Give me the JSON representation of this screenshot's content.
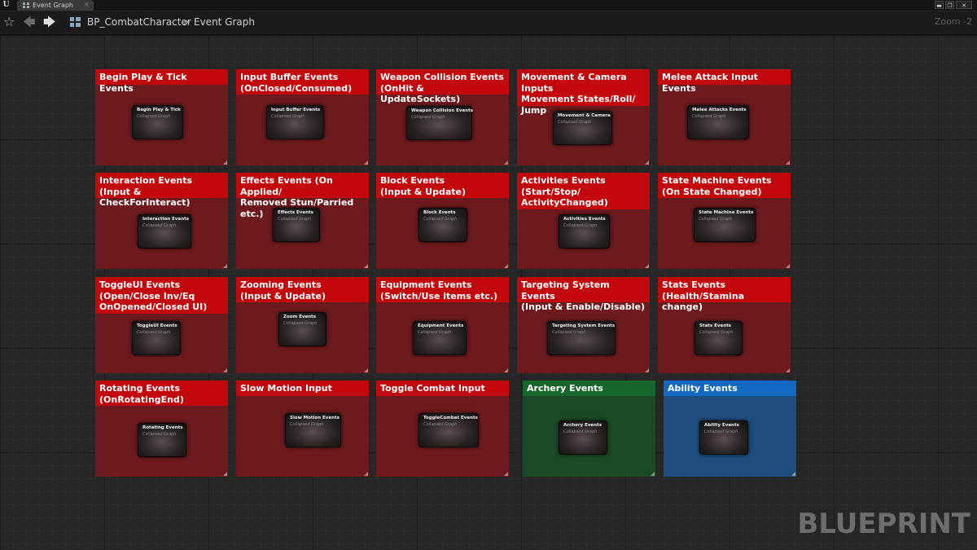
{
  "window": {
    "tab_label": "Event Graph",
    "tab_close": "×",
    "logo_text": "U",
    "controls": [
      "▬",
      "❐",
      "✕"
    ]
  },
  "navbar": {
    "star_icon": "☆",
    "back_icon": "🡄",
    "forward_icon": "🡆",
    "breadcrumb_blueprint": "BP_CombatCharacter",
    "breadcrumb_separator": ">",
    "breadcrumb_graph": "Event Graph",
    "zoom": "Zoom -2"
  },
  "watermark": "BLUEPRINT",
  "colors": {
    "red_header": "#c2080c",
    "red_body": "#6c1a1d",
    "green_header": "#17662c",
    "green_body": "#1a4a25",
    "blue_header": "#1468c4",
    "blue_body": "#1c4d7c",
    "canvas": "#262626"
  },
  "comments": [
    {
      "title": "Begin Play & Tick Events",
      "color": "red",
      "node_title": "Begin Play & Tick",
      "node_sub": "Collapsed Graph"
    },
    {
      "title": "Input Buffer Events\n(OnClosed/Consumed)",
      "color": "red",
      "node_title": "Input Buffer Events",
      "node_sub": "Collapsed Graph"
    },
    {
      "title": "Weapon Collision Events\n(OnHit & UpdateSockets)",
      "color": "red",
      "node_title": "Weapon Collision Events",
      "node_sub": "Collapsed Graph"
    },
    {
      "title": "Movement & Camera Inputs\nMovement States/Roll/\nJump",
      "color": "red",
      "node_title": "Movement & Camera",
      "node_sub": "Collapsed Graph"
    },
    {
      "title": "Melee Attack Input Events",
      "color": "red",
      "node_title": "Melee Attacks Events",
      "node_sub": "Collapsed Graph"
    },
    {
      "title": "Interaction Events\n(Input & CheckForInteract)",
      "color": "red",
      "node_title": "Interaction Events",
      "node_sub": "Collapsed Graph"
    },
    {
      "title": "Effects Events (On Applied/\nRemoved Stun/Parried etc.)",
      "color": "red",
      "node_title": "Effects Events",
      "node_sub": "Collapsed Graph"
    },
    {
      "title": "Block Events\n(Input & Update)",
      "color": "red",
      "node_title": "Block Events",
      "node_sub": "Collapsed Graph"
    },
    {
      "title": "Activities Events\n(Start/Stop/\nActivityChanged)",
      "color": "red",
      "node_title": "Activities Events",
      "node_sub": "Collapsed Graph"
    },
    {
      "title": "State Machine Events\n(On State Changed)",
      "color": "red",
      "node_title": "State Machine Events",
      "node_sub": "Collapsed Graph"
    },
    {
      "title": "ToggleUI Events\n(Open/Close Inv/Eq\nOnOpened/Closed UI)",
      "color": "red",
      "node_title": "ToggleUI Events",
      "node_sub": "Collapsed Graph"
    },
    {
      "title": "Zooming Events\n(Input & Update)",
      "color": "red",
      "node_title": "Zoom Events",
      "node_sub": "Collapsed Graph"
    },
    {
      "title": "Equipment Events\n(Switch/Use items etc.)",
      "color": "red",
      "node_title": "Equipment Events",
      "node_sub": "Collapsed Graph"
    },
    {
      "title": "Targeting System Events\n(Input & Enable/Disable)",
      "color": "red",
      "node_title": "Targeting System Events",
      "node_sub": "Collapsed Graph"
    },
    {
      "title": "Stats Events\n(Health/Stamina change)",
      "color": "red",
      "node_title": "Stats Events",
      "node_sub": "Collapsed Graph"
    },
    {
      "title": "Rotating Events\n(OnRotatingEnd)",
      "color": "red",
      "node_title": "Rotating Events",
      "node_sub": "Collapsed Graph"
    },
    {
      "title": "Slow Motion Input",
      "color": "red",
      "node_title": "Slow Motion Events",
      "node_sub": "Collapsed Graph"
    },
    {
      "title": "Toggle Combat Input",
      "color": "red",
      "node_title": "ToggleCombat Events",
      "node_sub": "Collapsed Graph"
    },
    {
      "title": "Archery Events",
      "color": "green",
      "node_title": "Archery Events",
      "node_sub": "Collapsed Graph"
    },
    {
      "title": "Ability Events",
      "color": "blue",
      "node_title": "Ability Events",
      "node_sub": "Collapsed Graph"
    }
  ]
}
